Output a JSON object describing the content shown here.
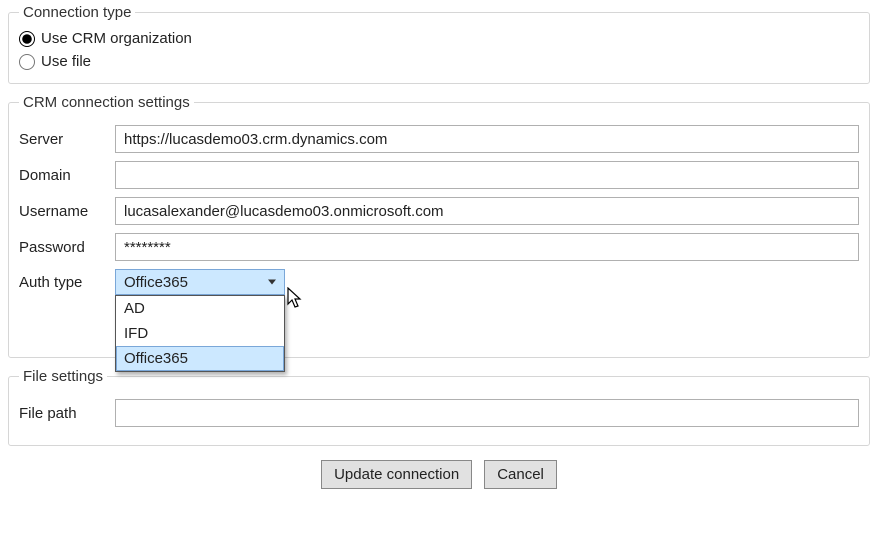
{
  "connType": {
    "legend": "Connection type",
    "optCrm": "Use CRM organization",
    "optFile": "Use file",
    "selected": "crm"
  },
  "crm": {
    "legend": "CRM connection settings",
    "serverLabel": "Server",
    "serverValue": "https://lucasdemo03.crm.dynamics.com",
    "domainLabel": "Domain",
    "domainValue": "",
    "usernameLabel": "Username",
    "usernameValue": "lucasalexander@lucasdemo03.onmicrosoft.com",
    "passwordLabel": "Password",
    "passwordValue": "********",
    "authLabel": "Auth type",
    "authSelected": "Office365",
    "authOptions": {
      "opt0": "AD",
      "opt1": "IFD",
      "opt2": "Office365"
    }
  },
  "file": {
    "legend": "File settings",
    "pathLabel": "File path",
    "pathValue": ""
  },
  "buttons": {
    "update": "Update connection",
    "cancel": "Cancel"
  }
}
